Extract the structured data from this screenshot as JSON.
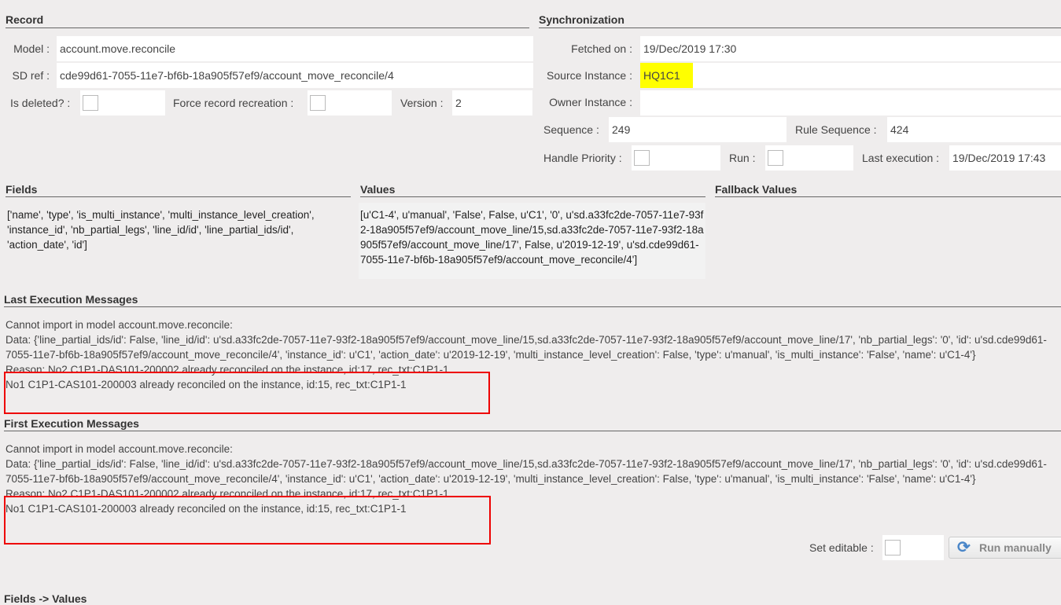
{
  "record": {
    "title": "Record",
    "model_label": "Model :",
    "model": "account.move.reconcile",
    "sdref_label": "SD ref :",
    "sdref": "cde99d61-7055-11e7-bf6b-18a905f57ef9/account_move_reconcile/4",
    "deleted_label": "Is deleted? :",
    "force_label": "Force record recreation :",
    "version_label": "Version :",
    "version": "2"
  },
  "sync": {
    "title": "Synchronization",
    "fetched_label": "Fetched on :",
    "fetched": "19/Dec/2019 17:30",
    "source_label": "Source Instance :",
    "source": "HQ1C1",
    "owner_label": "Owner Instance :",
    "owner": "",
    "sequence_label": "Sequence :",
    "sequence": "249",
    "rule_seq_label": "Rule Sequence :",
    "rule_seq": "424",
    "priority_label": "Handle Priority :",
    "run_label": "Run :",
    "last_exec_label": "Last execution :",
    "last_exec": "19/Dec/2019 17:43",
    "highlight": "#ffff00"
  },
  "fields": {
    "title": "Fields",
    "content": "['name', 'type', 'is_multi_instance', 'multi_instance_level_creation', 'instance_id', 'nb_partial_legs', 'line_id/id', 'line_partial_ids/id', 'action_date', 'id']"
  },
  "values": {
    "title": "Values",
    "content": "[u'C1-4', u'manual', 'False', False, u'C1', '0', u'sd.a33fc2de-7057-11e7-93f2-18a905f57ef9/account_move_line/15,sd.a33fc2de-7057-11e7-93f2-18a905f57ef9/account_move_line/17', False, u'2019-12-19', u'sd.cde99d61-7055-11e7-bf6b-18a905f57ef9/account_move_reconcile/4']"
  },
  "fallback": {
    "title": "Fallback Values"
  },
  "last_exec": {
    "title": "Last Execution Messages",
    "line1": "Cannot import in model account.move.reconcile:",
    "data": "Data: {'line_partial_ids/id': False, 'line_id/id': u'sd.a33fc2de-7057-11e7-93f2-18a905f57ef9/account_move_line/15,sd.a33fc2de-7057-11e7-93f2-18a905f57ef9/account_move_line/17', 'nb_partial_legs': '0', 'id': u'sd.cde99d61-7055-11e7-bf6b-18a905f57ef9/account_move_reconcile/4', 'instance_id': u'C1', 'action_date': u'2019-12-19', 'multi_instance_level_creation': False, 'type': u'manual', 'is_multi_instance': 'False', 'name': u'C1-4'}",
    "reason1": "Reason: No2 C1P1-DAS101-200002 already reconciled on the instance, id:17, rec_txt:C1P1-1",
    "reason2": "No1 C1P1-CAS101-200003 already reconciled on the instance, id:15, rec_txt:C1P1-1"
  },
  "first_exec": {
    "title": "First Execution Messages",
    "line1": "Cannot import in model account.move.reconcile:",
    "data": "Data: {'line_partial_ids/id': False, 'line_id/id': u'sd.a33fc2de-7057-11e7-93f2-18a905f57ef9/account_move_line/15,sd.a33fc2de-7057-11e7-93f2-18a905f57ef9/account_move_line/17', 'nb_partial_legs': '0', 'id': u'sd.cde99d61-7055-11e7-bf6b-18a905f57ef9/account_move_reconcile/4', 'instance_id': u'C1', 'action_date': u'2019-12-19', 'multi_instance_level_creation': False, 'type': u'manual', 'is_multi_instance': 'False', 'name': u'C1-4'}",
    "reason1": "Reason: No2 C1P1-DAS101-200002 already reconciled on the instance, id:17, rec_txt:C1P1-1",
    "reason2": "No1 C1P1-CAS101-200003 already reconciled on the instance, id:15, rec_txt:C1P1-1"
  },
  "actions": {
    "set_editable_label": "Set editable :",
    "run_manually": "Run manually"
  },
  "fields_values": {
    "title": "Fields -> Values"
  }
}
